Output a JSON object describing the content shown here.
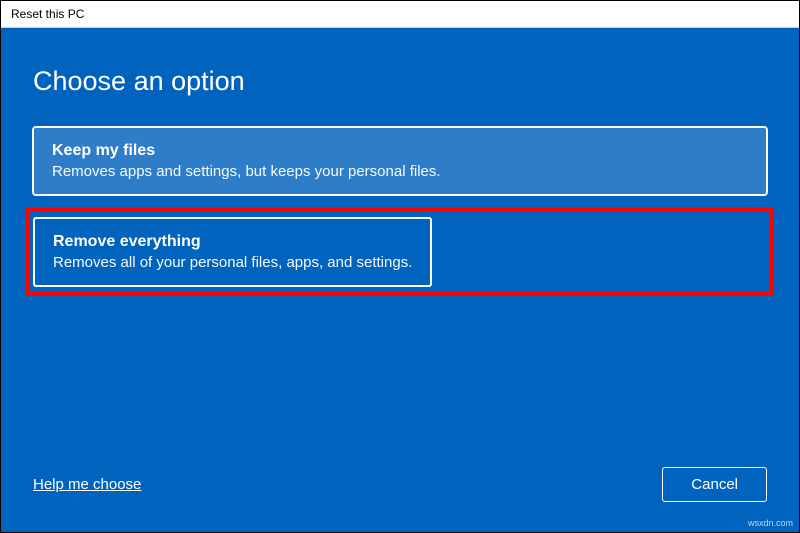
{
  "window": {
    "title": "Reset this PC"
  },
  "heading": "Choose an option",
  "options": [
    {
      "title": "Keep my files",
      "description": "Removes apps and settings, but keeps your personal files."
    },
    {
      "title": "Remove everything",
      "description": "Removes all of your personal files, apps, and settings."
    }
  ],
  "helpLink": "Help me choose",
  "cancel": "Cancel",
  "watermark": "wsxdn.com",
  "colors": {
    "panel": "#0063be",
    "selected": "#2d7dc8",
    "highlight": "#ff0000"
  }
}
